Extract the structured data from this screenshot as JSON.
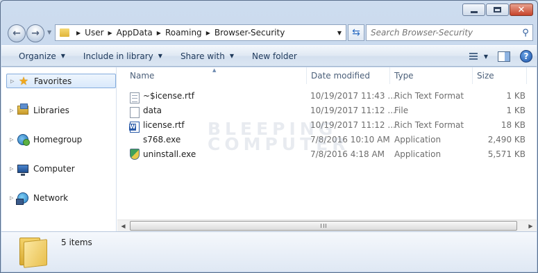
{
  "window": {
    "caption_buttons": [
      "minimize",
      "maximize",
      "close"
    ]
  },
  "nav": {
    "breadcrumb": [
      "User",
      "AppData",
      "Roaming",
      "Browser-Security"
    ],
    "search_placeholder": "Search Browser-Security"
  },
  "commands": {
    "organize": "Organize",
    "include_in_library": "Include in library",
    "share_with": "Share with",
    "new_folder": "New folder"
  },
  "sidebar": {
    "items": [
      {
        "label": "Favorites",
        "icon": "star-icon",
        "selected": true
      },
      {
        "label": "Libraries",
        "icon": "libraries-icon",
        "selected": false
      },
      {
        "label": "Homegroup",
        "icon": "homegroup-icon",
        "selected": false
      },
      {
        "label": "Computer",
        "icon": "computer-icon",
        "selected": false
      },
      {
        "label": "Network",
        "icon": "network-icon",
        "selected": false
      }
    ]
  },
  "columns": {
    "name": "Name",
    "date": "Date modified",
    "type": "Type",
    "size": "Size"
  },
  "files": [
    {
      "name": "~$icense.rtf",
      "date": "10/19/2017 11:43 ...",
      "type": "Rich Text Format",
      "size": "1 KB",
      "icon": "rtf-document-icon"
    },
    {
      "name": "data",
      "date": "10/19/2017 11:12 ...",
      "type": "File",
      "size": "1 KB",
      "icon": "blank-file-icon"
    },
    {
      "name": "license.rtf",
      "date": "10/19/2017 11:12 ...",
      "type": "Rich Text Format",
      "size": "18 KB",
      "icon": "word-document-icon"
    },
    {
      "name": "s768.exe",
      "date": "7/8/2016 10:10 AM",
      "type": "Application",
      "size": "2,490 KB",
      "icon": ""
    },
    {
      "name": "uninstall.exe",
      "date": "7/8/2016 4:18 AM",
      "type": "Application",
      "size": "5,571 KB",
      "icon": "shield-app-icon"
    }
  ],
  "watermark": {
    "line1": "BLEEPING",
    "line2": "COMPUTER"
  },
  "status": {
    "item_count": "5 items"
  }
}
